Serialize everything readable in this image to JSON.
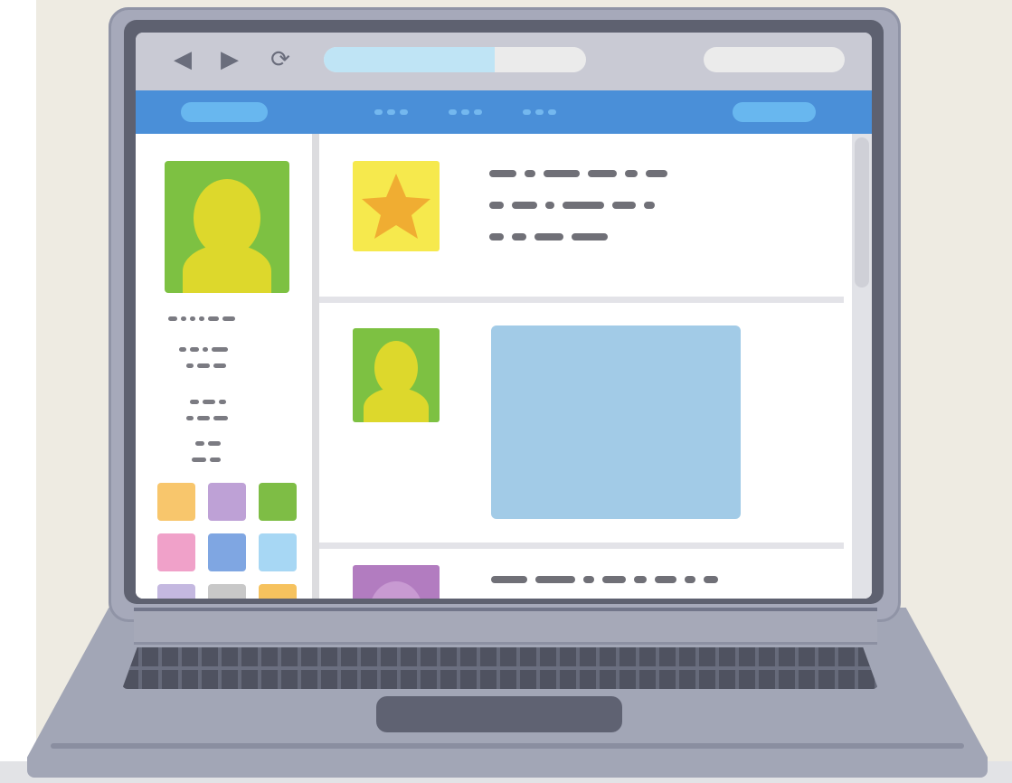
{
  "illustration": "laptop-browser-social-feed",
  "colors": {
    "header": "#4a8fd8",
    "header_pill": "#68b7ef",
    "address_progress": "#bfe4f5",
    "profile_green": "#7dc142",
    "silhouette_yellow": "#ddd82c",
    "star_tile": "#f6e94d",
    "star": "#f0ad32",
    "image_box": "#a2cbe7",
    "purple_avatar": "#b27cc0"
  },
  "browser": {
    "back_icon": "◀",
    "forward_icon": "▶",
    "reload_icon": "⟳",
    "page_load_progress": 0.65
  },
  "sidebar": {
    "color_tiles": [
      "#f8c66c",
      "#bea1d6",
      "#7ebd45",
      "#f0a1c9",
      "#7fa6e2",
      "#a7d7f4",
      "#c4b8e0",
      "#c8c8c8",
      "#f6c25e"
    ]
  },
  "feed": {
    "post_avatars": [
      "star-tile",
      "user-green",
      "user-purple"
    ]
  }
}
